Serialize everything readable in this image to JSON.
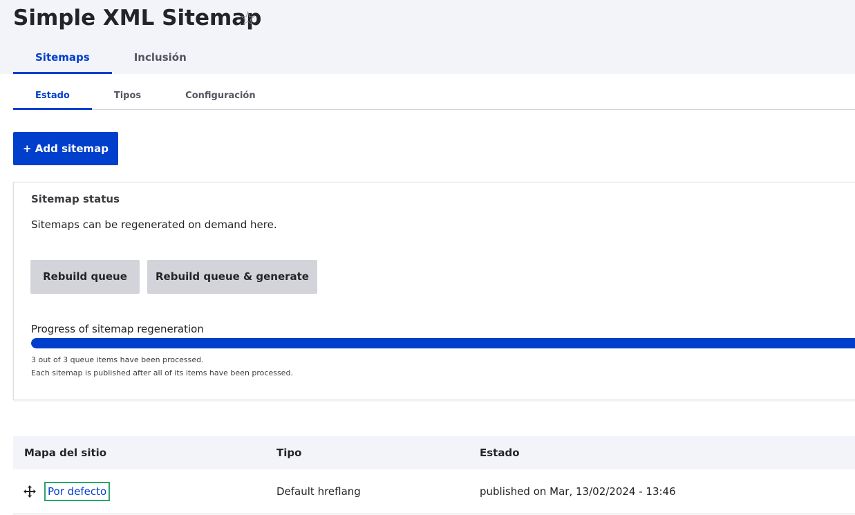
{
  "page": {
    "title": "Simple XML Sitemap",
    "star_glyph": "☆"
  },
  "primary_tabs": [
    {
      "label": "Sitemaps",
      "active": true
    },
    {
      "label": "Inclusión",
      "active": false
    }
  ],
  "secondary_tabs": [
    {
      "label": "Estado",
      "active": true
    },
    {
      "label": "Tipos",
      "active": false
    },
    {
      "label": "Configuración",
      "active": false
    }
  ],
  "add_button": {
    "label": "+ Add sitemap"
  },
  "status": {
    "title": "Sitemap status",
    "description": "Sitemaps can be regenerated on demand here.",
    "rebuild_label": "Rebuild queue",
    "rebuild_generate_label": "Rebuild queue & generate",
    "progress_label": "Progress of sitemap regeneration",
    "progress_percent": 100,
    "processed_message": "3 out of 3 queue items have been processed.",
    "publish_note": "Each sitemap is published after all of its items have been processed."
  },
  "table": {
    "headers": [
      "Mapa del sitio",
      "Tipo",
      "Estado"
    ],
    "rows": [
      {
        "sitemap": "Por defecto",
        "type": "Default hreflang",
        "status": "published on Mar, 13/02/2024 - 13:46"
      }
    ]
  },
  "colors": {
    "accent": "#003ecc",
    "focus_ring": "#26a769",
    "header_bg": "#f3f4f9",
    "button_gray": "#d3d4d9"
  },
  "icons": {
    "favorite": "star-outline-icon",
    "row_drag": "drag-move-icon"
  }
}
